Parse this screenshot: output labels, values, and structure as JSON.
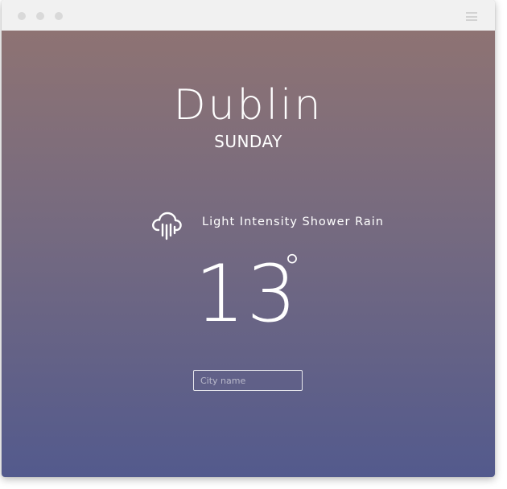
{
  "window": {
    "controls": [
      "window-dot",
      "window-dot",
      "window-dot"
    ],
    "menu_icon": "hamburger-menu-icon"
  },
  "weather": {
    "city": "Dublin",
    "day": "SUNDAY",
    "condition": "Light Intensity Shower Rain",
    "condition_icon": "rain-cloud-icon",
    "temperature": "13",
    "degree_symbol": "°"
  },
  "search": {
    "placeholder": "City name",
    "value": ""
  },
  "colors": {
    "gradient_top": "#8e7373",
    "gradient_bottom": "#535a8d",
    "titlebar": "#f1f1f1",
    "text": "#ffffff"
  }
}
